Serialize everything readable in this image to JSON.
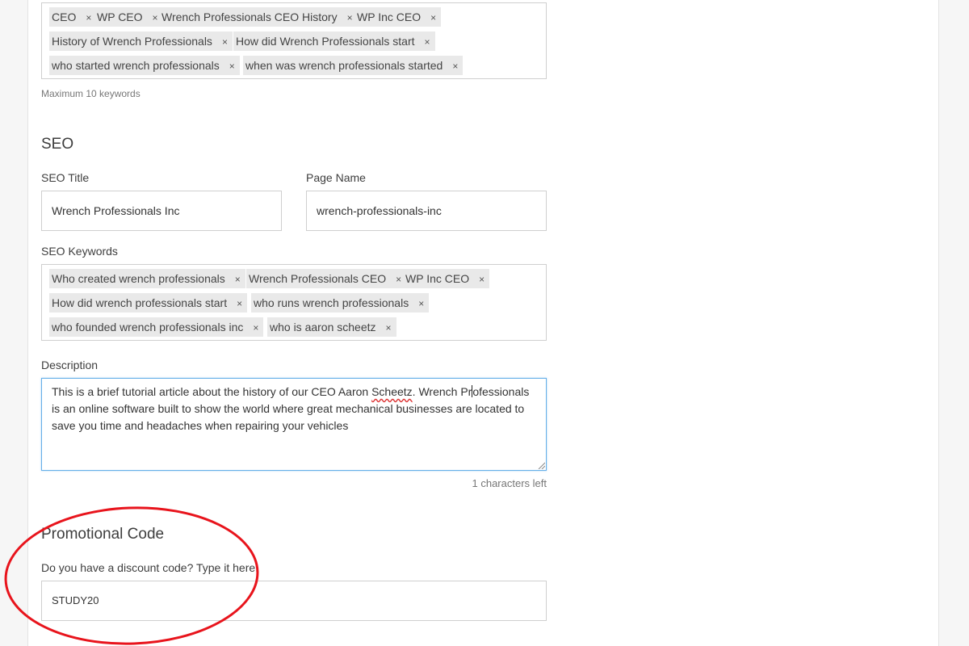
{
  "top_keywords": {
    "tags": [
      "CEO",
      "WP CEO",
      "Wrench Professionals CEO History",
      "WP Inc CEO",
      "History of Wrench Professionals",
      "How did Wrench Professionals start",
      "who started wrench professionals",
      "when was wrench professionals started"
    ],
    "remove_glyph": "×",
    "hint": "Maximum 10 keywords"
  },
  "seo": {
    "heading": "SEO",
    "title_label": "SEO Title",
    "title_value": "Wrench Professionals Inc",
    "page_name_label": "Page Name",
    "page_name_value": "wrench-professionals-inc",
    "keywords_label": "SEO Keywords",
    "keywords": [
      "Who created wrench professionals",
      "Wrench Professionals CEO",
      "WP Inc CEO",
      "How did wrench professionals start",
      "who runs wrench professionals",
      "who founded wrench professionals inc",
      "who is aaron scheetz"
    ],
    "description_label": "Description",
    "description": {
      "part1": "This is a brief tutorial article about the history of our CEO Aaron ",
      "misspelled": "Scheetz",
      "part2": ". Wrench Pr",
      "part3": "ofessionals is an online software built to show the world where great mechanical businesses are located to save you time and headaches when repairing your vehicles"
    },
    "chars_left": "1 characters left"
  },
  "promo": {
    "heading": "Promotional Code",
    "label": "Do you have a discount code? Type it here.",
    "value": "STUDY20",
    "highlight_color": "#e8141c"
  }
}
